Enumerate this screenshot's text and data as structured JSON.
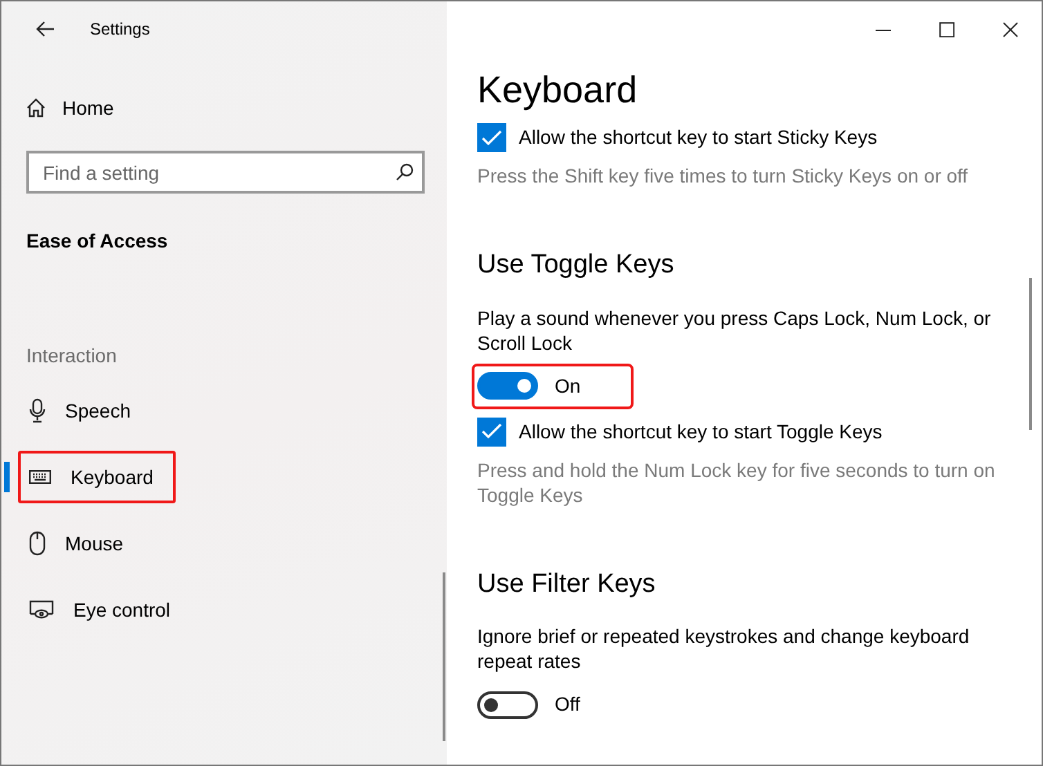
{
  "window": {
    "title": "Settings"
  },
  "sidebar": {
    "home": "Home",
    "search": {
      "placeholder": "Find a setting"
    },
    "category": "Ease of Access",
    "group": "Interaction",
    "items": [
      {
        "label": "Speech",
        "selected": false,
        "highlighted": false
      },
      {
        "label": "Keyboard",
        "selected": true,
        "highlighted": true
      },
      {
        "label": "Mouse",
        "selected": false,
        "highlighted": false
      },
      {
        "label": "Eye control",
        "selected": false,
        "highlighted": false
      }
    ]
  },
  "page": {
    "title": "Keyboard",
    "blocks": [
      {
        "kind": "checkbox",
        "label": "Allow the shortcut key to start Sticky Keys",
        "checked": true
      },
      {
        "kind": "description",
        "text": "Press the Shift key five times to turn Sticky Keys on or off"
      },
      {
        "kind": "heading",
        "text": "Use Toggle Keys"
      },
      {
        "kind": "text",
        "text": "Play a sound whenever you press Caps Lock, Num Lock, or Scroll Lock"
      },
      {
        "kind": "toggle",
        "label": "On",
        "on": true,
        "highlighted": true
      },
      {
        "kind": "checkbox",
        "label": "Allow the shortcut key to start Toggle Keys",
        "checked": true
      },
      {
        "kind": "description",
        "text": "Press and hold the Num Lock key for five seconds to turn on Toggle Keys"
      },
      {
        "kind": "heading",
        "text": "Use Filter Keys"
      },
      {
        "kind": "text",
        "text": "Ignore brief or repeated keystrokes and change keyboard repeat rates"
      },
      {
        "kind": "toggle",
        "label": "Off",
        "on": false,
        "highlighted": false
      }
    ]
  }
}
